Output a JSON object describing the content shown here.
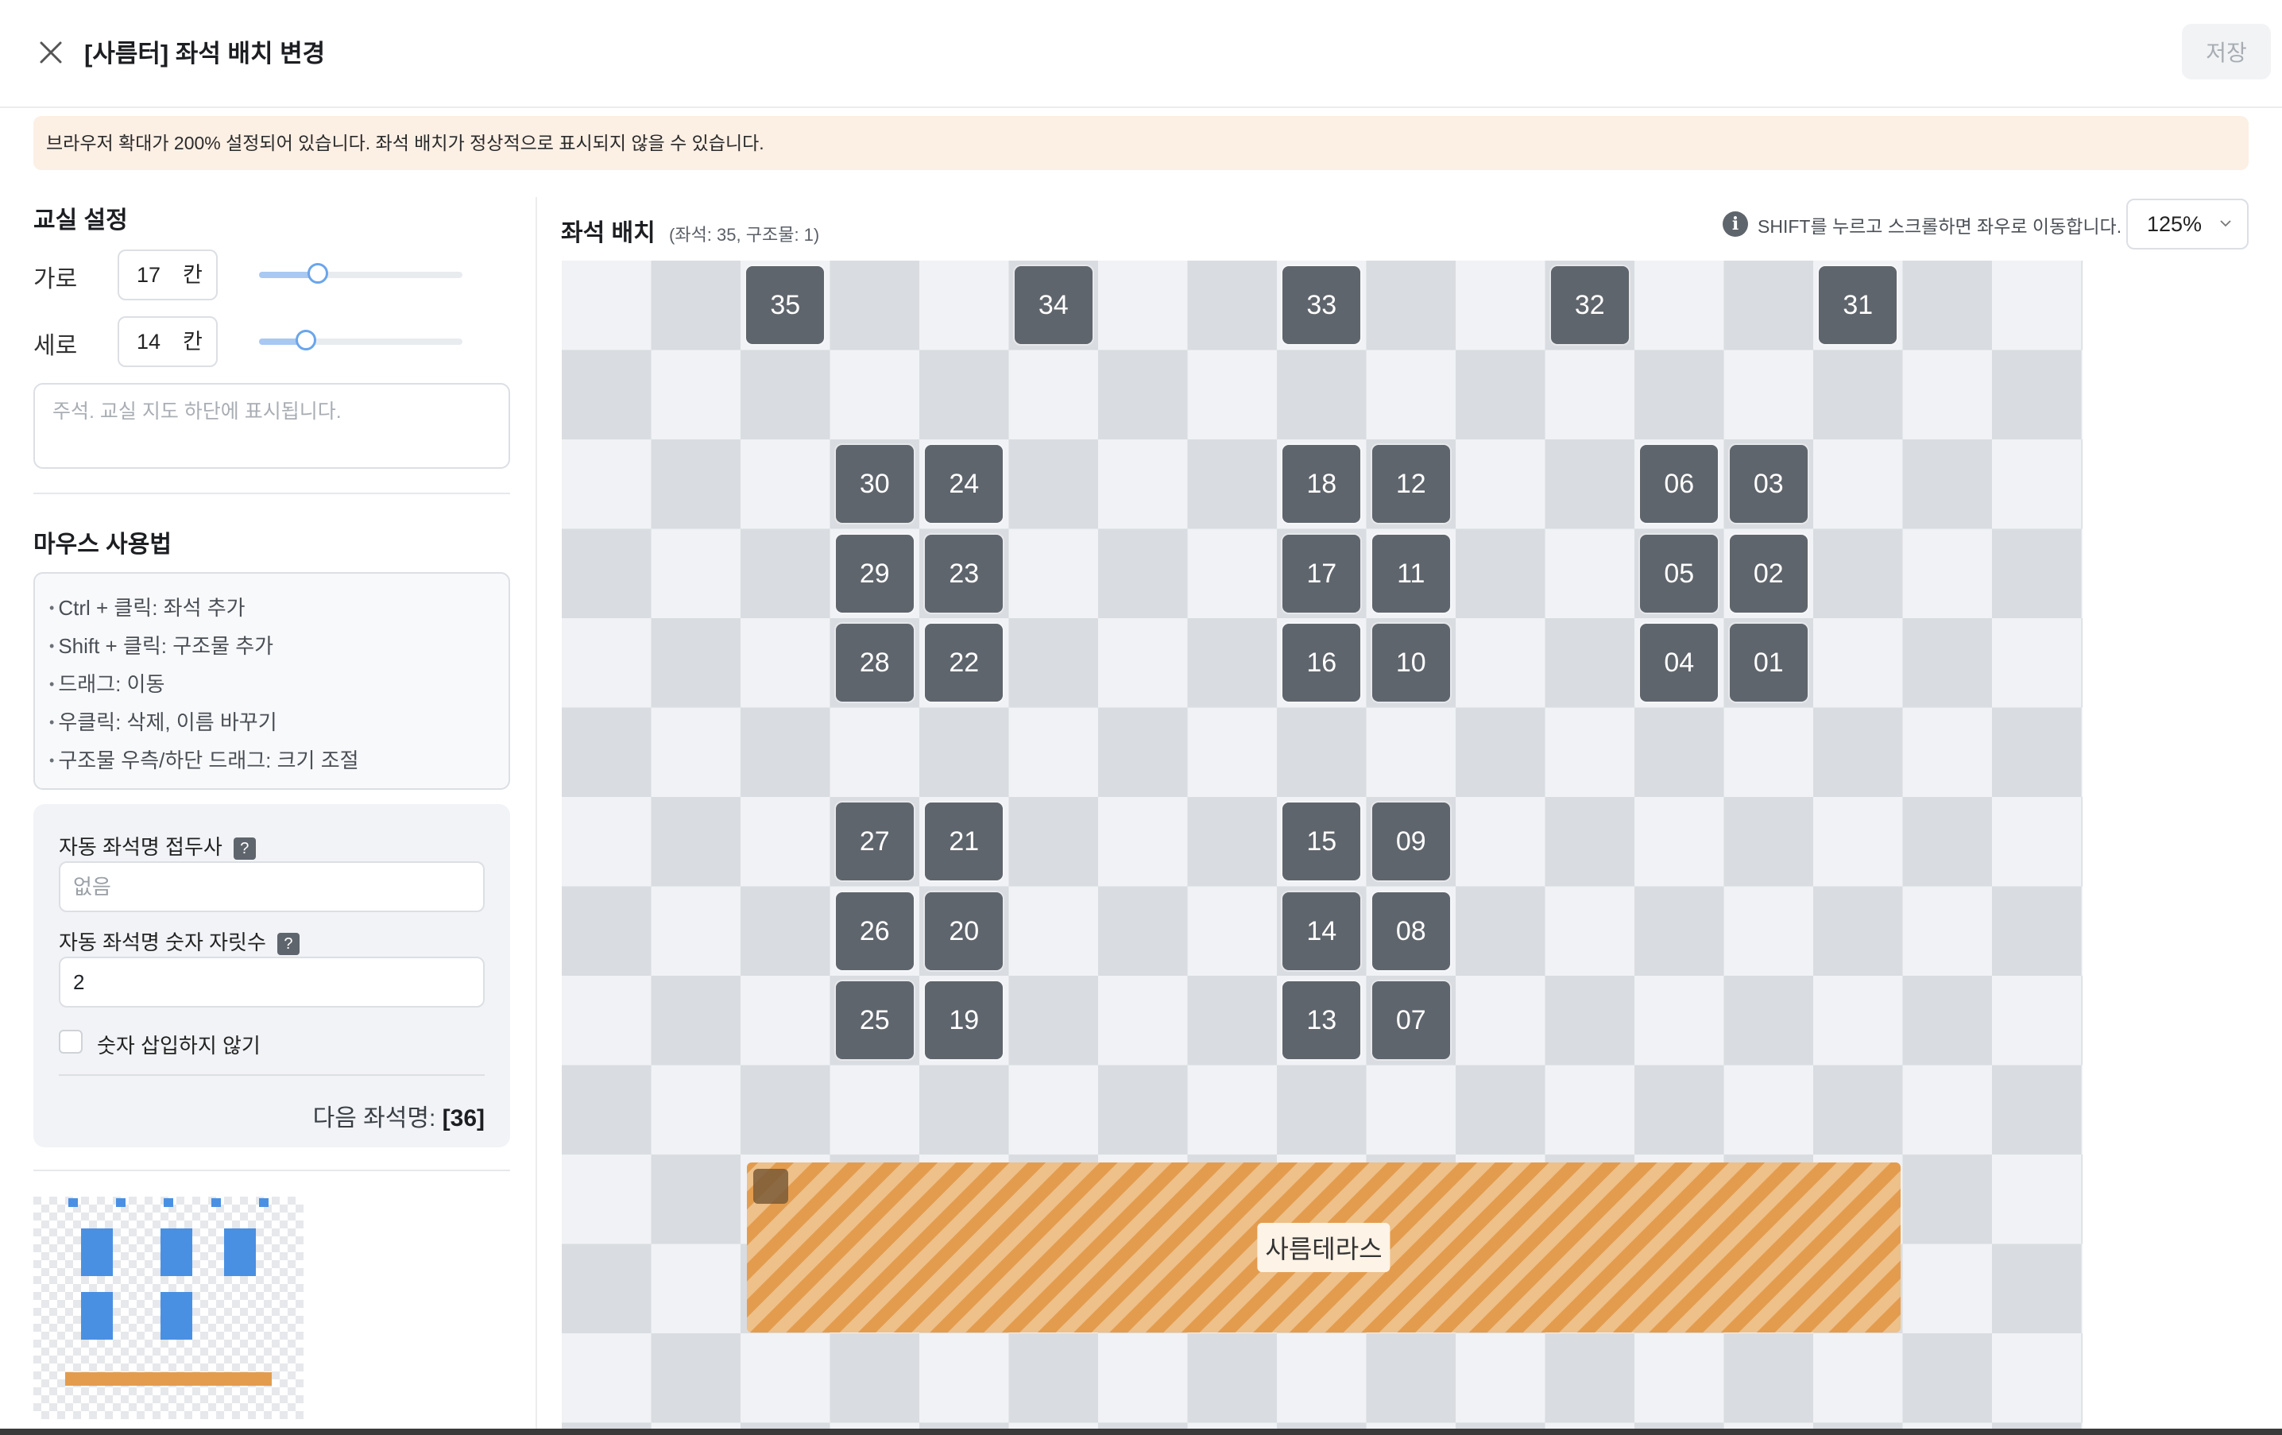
{
  "header": {
    "title": "[사름터] 좌석 배치 변경",
    "save_label": "저장"
  },
  "warning": "브라우저 확대가 200% 설정되어 있습니다. 좌석 배치가 정상적으로 표시되지 않을 수 있습니다.",
  "classroom": {
    "title": "교실 설정",
    "width_label": "가로",
    "width_value": "17",
    "height_label": "세로",
    "height_value": "14",
    "unit": "칸",
    "width_slider_fraction": 0.29,
    "height_slider_fraction": 0.23,
    "note_placeholder": "주석. 교실 지도 하단에 표시됩니다."
  },
  "mouse_help": {
    "title": "마우스 사용법",
    "items": [
      "Ctrl + 클릭: 좌석 추가",
      "Shift + 클릭: 구조물 추가",
      "드래그: 이동",
      "우클릭: 삭제, 이름 바꾸기",
      "구조물 우측/하단 드래그: 크기 조절"
    ]
  },
  "auto_name": {
    "prefix_label": "자동 좌석명 접두사",
    "prefix_placeholder": "없음",
    "digits_label": "자동 좌석명 숫자 자릿수",
    "digits_value": "2",
    "no_number_label": "숫자 삽입하지 않기",
    "help_icon": "?",
    "next_label": "다음 좌석명:",
    "next_value": "[36]"
  },
  "layout": {
    "title": "좌석 배치",
    "subtitle": "(좌석: 35, 구조물: 1)",
    "hint": "SHIFT를 누르고 스크롤하면 좌우로 이동합니다.",
    "zoom": "125%",
    "grid_cols": 17,
    "grid_rows": 14,
    "seats": [
      {
        "label": "35",
        "col": 2,
        "row": 0
      },
      {
        "label": "34",
        "col": 5,
        "row": 0
      },
      {
        "label": "33",
        "col": 8,
        "row": 0
      },
      {
        "label": "32",
        "col": 11,
        "row": 0
      },
      {
        "label": "31",
        "col": 14,
        "row": 0
      },
      {
        "label": "30",
        "col": 3,
        "row": 2
      },
      {
        "label": "24",
        "col": 4,
        "row": 2
      },
      {
        "label": "18",
        "col": 8,
        "row": 2
      },
      {
        "label": "12",
        "col": 9,
        "row": 2
      },
      {
        "label": "06",
        "col": 12,
        "row": 2
      },
      {
        "label": "03",
        "col": 13,
        "row": 2
      },
      {
        "label": "29",
        "col": 3,
        "row": 3
      },
      {
        "label": "23",
        "col": 4,
        "row": 3
      },
      {
        "label": "17",
        "col": 8,
        "row": 3
      },
      {
        "label": "11",
        "col": 9,
        "row": 3
      },
      {
        "label": "05",
        "col": 12,
        "row": 3
      },
      {
        "label": "02",
        "col": 13,
        "row": 3
      },
      {
        "label": "28",
        "col": 3,
        "row": 4
      },
      {
        "label": "22",
        "col": 4,
        "row": 4
      },
      {
        "label": "16",
        "col": 8,
        "row": 4
      },
      {
        "label": "10",
        "col": 9,
        "row": 4
      },
      {
        "label": "04",
        "col": 12,
        "row": 4
      },
      {
        "label": "01",
        "col": 13,
        "row": 4
      },
      {
        "label": "27",
        "col": 3,
        "row": 6
      },
      {
        "label": "21",
        "col": 4,
        "row": 6
      },
      {
        "label": "15",
        "col": 8,
        "row": 6
      },
      {
        "label": "09",
        "col": 9,
        "row": 6
      },
      {
        "label": "26",
        "col": 3,
        "row": 7
      },
      {
        "label": "20",
        "col": 4,
        "row": 7
      },
      {
        "label": "14",
        "col": 8,
        "row": 7
      },
      {
        "label": "08",
        "col": 9,
        "row": 7
      },
      {
        "label": "25",
        "col": 3,
        "row": 8
      },
      {
        "label": "19",
        "col": 4,
        "row": 8
      },
      {
        "label": "13",
        "col": 8,
        "row": 8
      },
      {
        "label": "07",
        "col": 9,
        "row": 8
      }
    ],
    "structure": {
      "label": "사름테라스"
    }
  },
  "colors": {
    "seat": "#5f656c",
    "structure": "#e39c4e",
    "mini_seat": "#4a90e2",
    "mini_structure": "#e39c4e"
  },
  "icons": {
    "close": "close-icon",
    "info": "info-icon",
    "zoom_dropdown": "chevron-down-icon"
  }
}
